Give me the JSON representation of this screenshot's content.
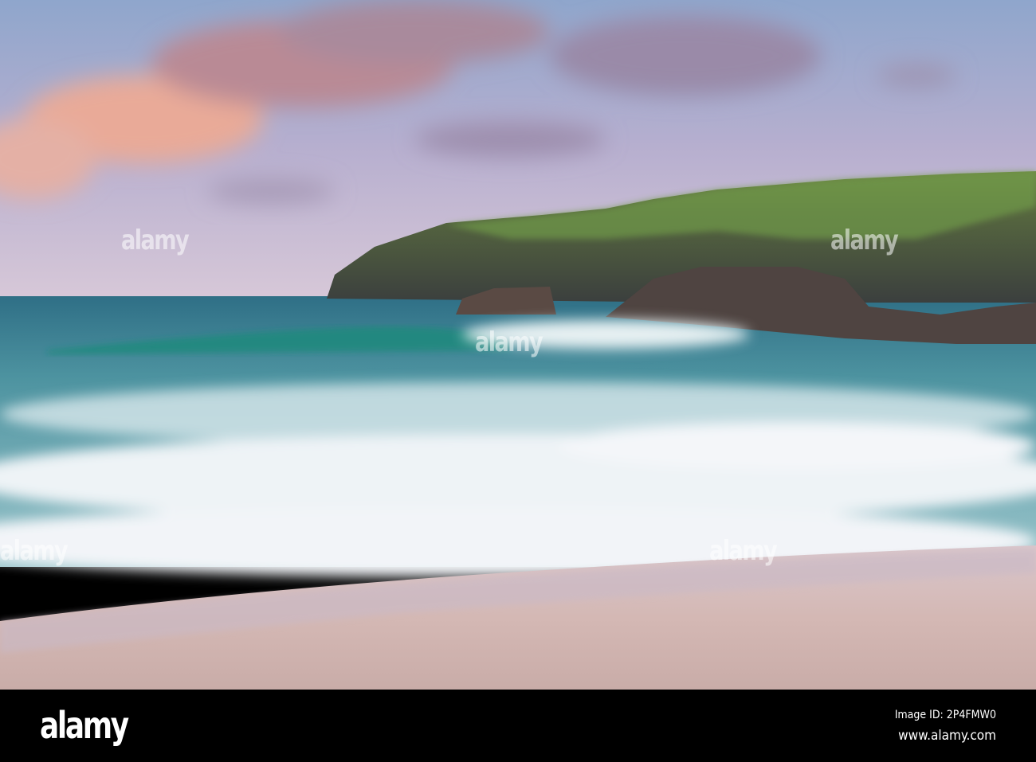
{
  "photo": {
    "subject": "Coastal beach with waves, headland and rocks at dusk",
    "watermark_text": "alamy"
  },
  "footer": {
    "logo": "alamy",
    "image_id": "Image ID: 2P4FMW0",
    "url": "www.alamy.com"
  }
}
